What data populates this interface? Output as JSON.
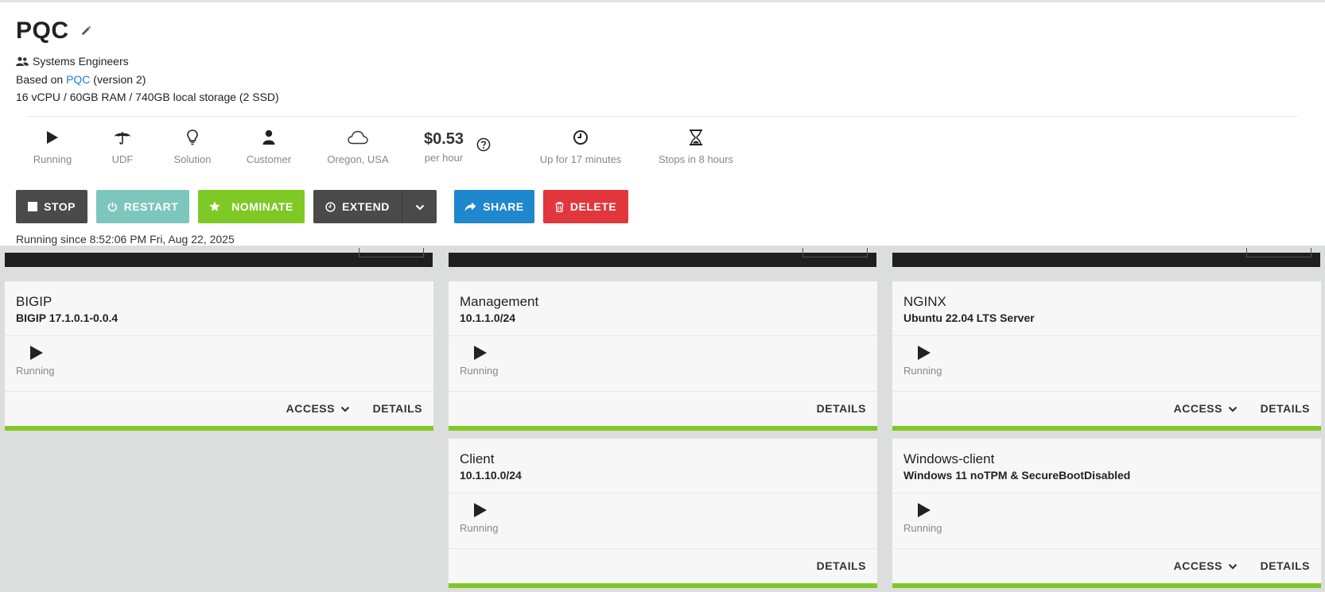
{
  "header": {
    "title": "PQC",
    "team": "Systems Engineers",
    "based_prefix": "Based on",
    "based_link": "PQC",
    "based_suffix": "(version 2)",
    "specs": "16 vCPU / 60GB RAM / 740GB local storage (2 SSD)"
  },
  "stats": {
    "state": "Running",
    "udf": "UDF",
    "solution": "Solution",
    "customer": "Customer",
    "region": "Oregon, USA",
    "price": "$0.53",
    "price_unit": "per hour",
    "uptime": "Up for 17 minutes",
    "stops": "Stops in 8 hours"
  },
  "actions": {
    "stop": "STOP",
    "restart": "RESTART",
    "nominate": "NOMINATE",
    "extend": "EXTEND",
    "share": "SHARE",
    "delete": "DELETE"
  },
  "running_since": "Running since 8:52:06 PM Fri, Aug 22, 2025",
  "cards": [
    {
      "title": "BIGIP",
      "subtitle": "BIGIP 17.1.0.1-0.0.4",
      "status": "Running",
      "access": "ACCESS",
      "details": "DETAILS"
    },
    {
      "title": "Management",
      "subtitle": "10.1.1.0/24",
      "status": "Running",
      "details": "DETAILS"
    },
    {
      "title": "NGINX",
      "subtitle": "Ubuntu 22.04 LTS Server",
      "status": "Running",
      "access": "ACCESS",
      "details": "DETAILS"
    },
    {
      "title": "Client",
      "subtitle": "10.1.10.0/24",
      "status": "Running",
      "details": "DETAILS"
    },
    {
      "title": "Windows-client",
      "subtitle": "Windows 11 noTPM & SecureBootDisabled",
      "status": "Running",
      "access": "ACCESS",
      "details": "DETAILS"
    }
  ],
  "colors": {
    "accent_green": "#7fc927",
    "link_blue": "#1a7fd0",
    "share_blue": "#1f87cc",
    "delete_red": "#e2363d",
    "restart_teal": "#7cc6bd",
    "dark_button": "#4a4a4a"
  },
  "icons": {
    "edit": "pencil-icon",
    "team": "users-icon",
    "state": "play-icon",
    "udf": "umbrella-icon",
    "solution": "lightbulb-icon",
    "customer": "user-icon",
    "region": "cloud-icon",
    "price_help": "question-circle-icon",
    "uptime": "clock-icon",
    "stops": "hourglass-icon"
  }
}
